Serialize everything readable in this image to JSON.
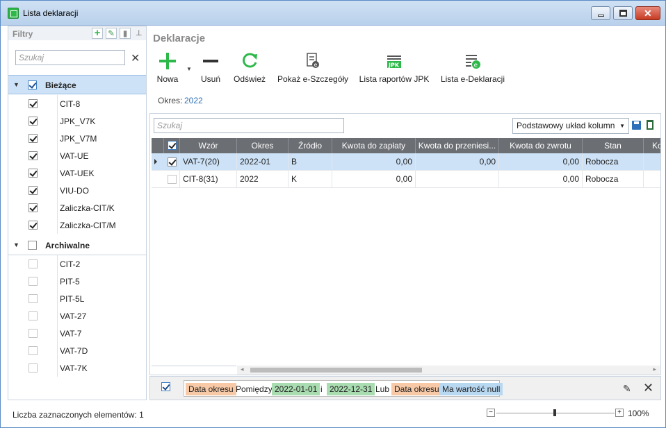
{
  "window": {
    "title": "Lista deklaracji"
  },
  "filters": {
    "title": "Filtry",
    "search_placeholder": "Szukaj",
    "groups": [
      {
        "label": "Bieżące",
        "checked": true,
        "items": [
          {
            "label": "CIT-8",
            "checked": true
          },
          {
            "label": "JPK_V7K",
            "checked": true
          },
          {
            "label": "JPK_V7M",
            "checked": true
          },
          {
            "label": "VAT-UE",
            "checked": true
          },
          {
            "label": "VAT-UEK",
            "checked": true
          },
          {
            "label": "VIU-DO",
            "checked": true
          },
          {
            "label": "Zaliczka-CIT/K",
            "checked": true
          },
          {
            "label": "Zaliczka-CIT/M",
            "checked": true
          }
        ]
      },
      {
        "label": "Archiwalne",
        "checked": false,
        "items": [
          {
            "label": "CIT-2",
            "checked": false
          },
          {
            "label": "PIT-5",
            "checked": false
          },
          {
            "label": "PIT-5L",
            "checked": false
          },
          {
            "label": "VAT-27",
            "checked": false
          },
          {
            "label": "VAT-7",
            "checked": false
          },
          {
            "label": "VAT-7D",
            "checked": false
          },
          {
            "label": "VAT-7K",
            "checked": false
          }
        ]
      }
    ]
  },
  "main": {
    "title": "Deklaracje",
    "toolbar": {
      "new": "Nowa",
      "delete": "Usuń",
      "refresh": "Odśwież",
      "details": "Pokaż e-Szczegóły",
      "jpk_reports": "Lista raportów JPK",
      "e_declarations": "Lista e-Deklaracji",
      "jpk_icon_text": "JPK"
    },
    "period_label": "Okres:",
    "period_value": "2022",
    "grid": {
      "search_placeholder": "Szukaj",
      "layout": "Podstawowy układ kolumn",
      "columns": [
        "Wzór",
        "Okres",
        "Źródło",
        "Kwota do zapłaty",
        "Kwota do przeniesi...",
        "Kwota do zwrotu",
        "Stan",
        "Ko"
      ],
      "rows": [
        {
          "selected": true,
          "checked": true,
          "cells": [
            "VAT-7(20)",
            "2022-01",
            "B",
            "0,00",
            "0,00",
            "0,00",
            "Robocza"
          ]
        },
        {
          "selected": false,
          "checked": false,
          "cells": [
            "CIT-8(31)",
            "2022",
            "K",
            "0,00",
            "",
            "0,00",
            "Robocza"
          ]
        }
      ]
    },
    "filter_expr": {
      "t1": "Data okresu",
      "t2": "Pomiędzy",
      "t3": "2022-01-01",
      "t4": "i",
      "t5": "2022-12-31",
      "t6": "Lub",
      "t7": "Data okresu",
      "t8": "Ma wartość null"
    }
  },
  "status": {
    "selected_count": "Liczba zaznaczonych elementów: 1",
    "zoom": "100%"
  },
  "colors": {
    "accent_green": "#2fb84a",
    "link_blue": "#2b6fb6",
    "header_gray": "#6b6e73",
    "selection": "#cde2f7"
  }
}
